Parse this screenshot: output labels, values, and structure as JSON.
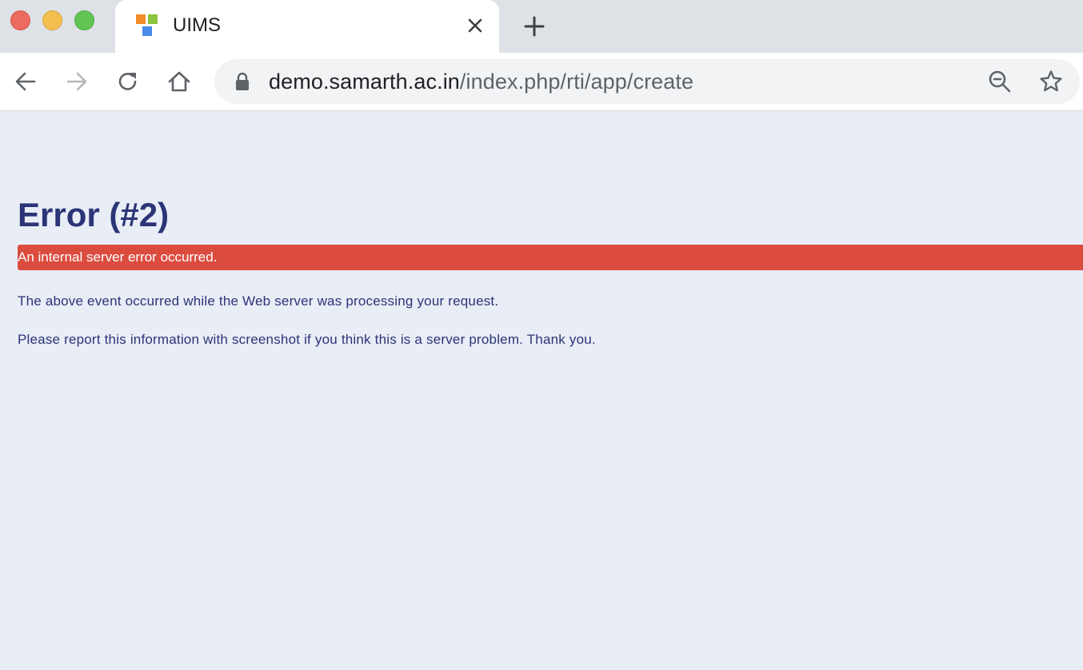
{
  "window": {
    "controls": [
      "close",
      "minimize",
      "maximize"
    ]
  },
  "tab": {
    "title": "UIMS",
    "favicon": "uims-logo",
    "close_icon": "close-icon",
    "new_tab_icon": "plus-icon"
  },
  "toolbar": {
    "back_icon": "arrow-left-icon",
    "forward_icon": "arrow-right-icon",
    "reload_icon": "reload-icon",
    "home_icon": "home-icon"
  },
  "omnibox": {
    "lock_icon": "lock-icon",
    "url_host": "demo.samarth.ac.in",
    "url_path": "/index.php/rti/app/create",
    "zoom_icon": "zoom-out-icon",
    "bookmark_icon": "star-icon"
  },
  "page": {
    "title": "Error (#2)",
    "banner": "An internal server error occurred.",
    "paragraph1": "The above event occurred while the Web server was processing your request.",
    "paragraph2": "Please report this information with screenshot if you think this is a server problem. Thank you."
  },
  "colors": {
    "page_bg": "#e9edf6",
    "title": "#2b3577",
    "banner_bg": "#db4c3f",
    "tabstrip_bg": "#dee1e6"
  }
}
